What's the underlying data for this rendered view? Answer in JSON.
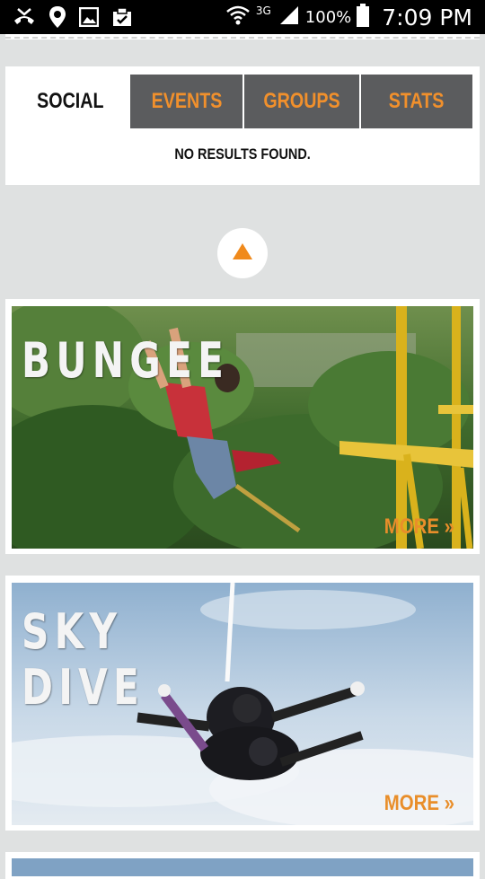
{
  "status_bar": {
    "network": "3G",
    "battery": "100%",
    "time": "7:09 PM"
  },
  "tabs": [
    {
      "label": "SOCIAL",
      "active": true
    },
    {
      "label": "EVENTS",
      "active": false
    },
    {
      "label": "GROUPS",
      "active": false
    },
    {
      "label": "STATS",
      "active": false
    }
  ],
  "social": {
    "empty_message": "NO RESULTS FOUND."
  },
  "activities": [
    {
      "title_lines": [
        "BUNGEE"
      ],
      "more_label": "MORE »"
    },
    {
      "title_lines": [
        "SKY",
        "DIVE"
      ],
      "more_label": "MORE »"
    }
  ],
  "colors": {
    "accent": "#f1902c",
    "tab_inactive_bg": "#5b5c5e",
    "page_bg": "#dfe1e1",
    "up_arrow": "#f08a1c"
  },
  "icons": [
    "missed-call-icon",
    "location-pin-icon",
    "gallery-icon",
    "clipboard-icon",
    "wifi-icon",
    "signal-icon",
    "battery-icon",
    "up-arrow-icon"
  ]
}
